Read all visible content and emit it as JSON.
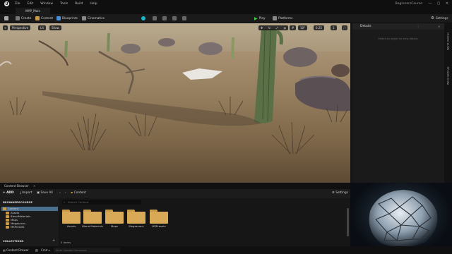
{
  "menubar": {
    "items": [
      "File",
      "Edit",
      "Window",
      "Tools",
      "Build",
      "Help"
    ],
    "project_name": "BeginnersCourse",
    "logo": "U"
  },
  "tab": {
    "label": "MAP_Main"
  },
  "toolbar": {
    "save_icon": "save-icon",
    "create_label": "Create",
    "content_label": "Content",
    "blueprints_label": "Blueprints",
    "cinematics_label": "Cinematics",
    "play_label": "Play",
    "platforms_label": "Platforms",
    "settings_label": "Settings"
  },
  "viewport": {
    "perspective_label": "Perspective",
    "lit_label": "Lit",
    "show_label": "Show",
    "snap_angle": "10°",
    "scale_value": "0.25",
    "camera_speed": "1"
  },
  "details": {
    "title": "Details",
    "empty_message": "Select an object to view details.",
    "side_tabs": [
      "World Outliner",
      "World Settings"
    ]
  },
  "content_browser": {
    "tab_label": "Content Browser",
    "add_label": "+ ADD",
    "import_label": "Import",
    "save_all_label": "Save All",
    "path_label": "Content",
    "settings_label": "Settings",
    "search_placeholder": "Search Content",
    "tree_root": "BEGINNERSCOURSE",
    "tree_items": [
      "Content",
      "Assets",
      "BlendMaterials",
      "Maps",
      "Megascans",
      "MSPresets"
    ],
    "folders": [
      "Assets",
      "Blend Materials",
      "Maps",
      "Megascans",
      "MSPresets"
    ],
    "item_count": "5 items",
    "collections_label": "COLLECTIONS"
  },
  "bottombar": {
    "content_drawer_label": "Content Drawer",
    "cmd_label": "Cmd",
    "console_placeholder": "Enter Console Command"
  }
}
